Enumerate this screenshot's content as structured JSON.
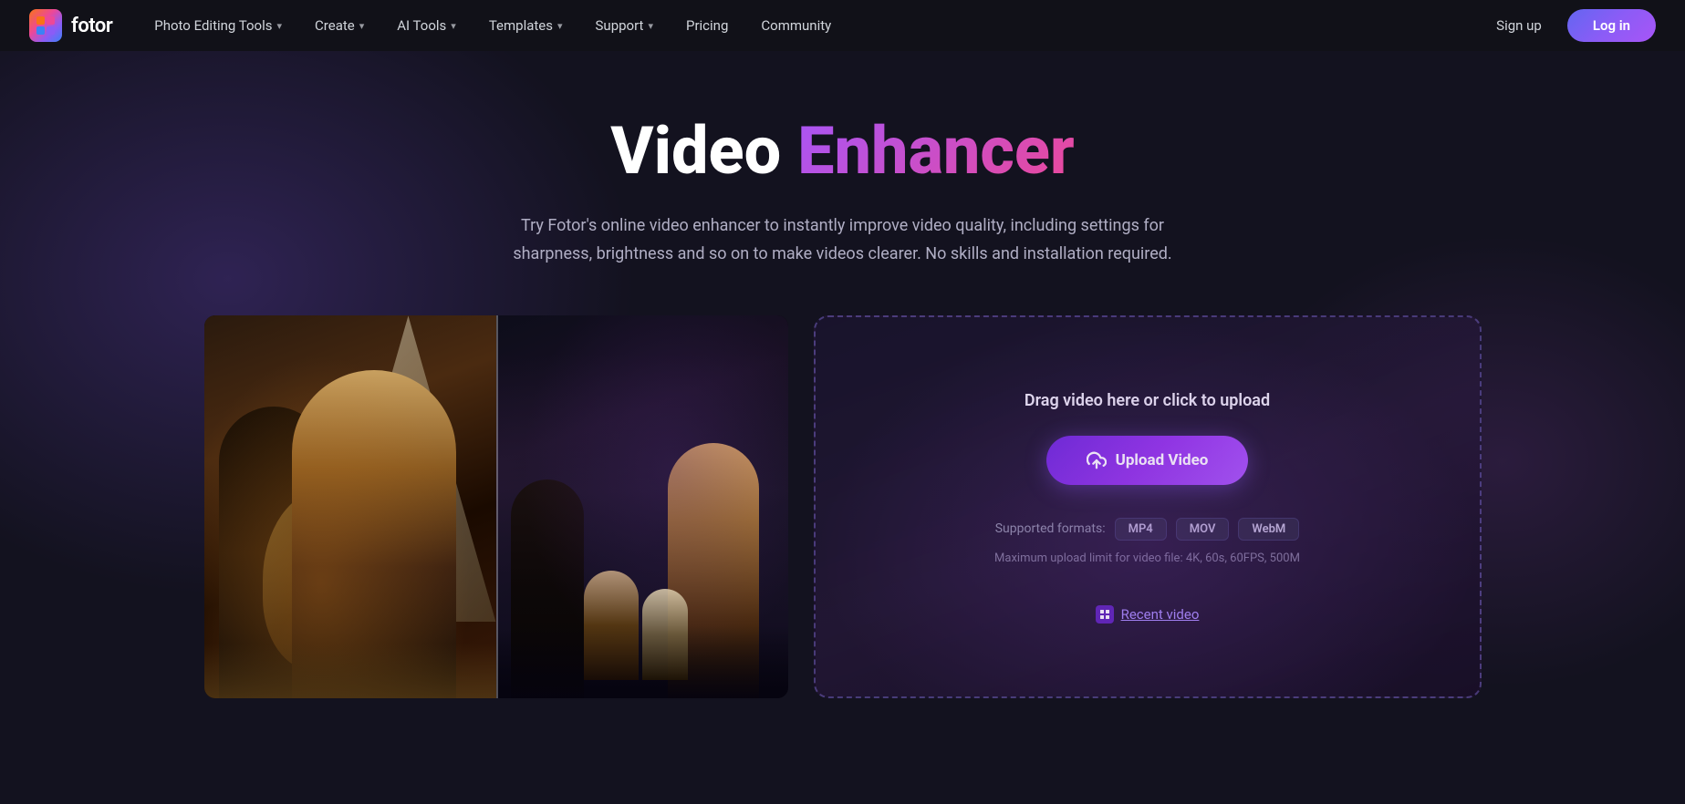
{
  "brand": {
    "logo_letter": "f",
    "name": "fotor"
  },
  "nav": {
    "items": [
      {
        "id": "photo-editing-tools",
        "label": "Photo Editing Tools",
        "has_dropdown": true
      },
      {
        "id": "create",
        "label": "Create",
        "has_dropdown": true
      },
      {
        "id": "ai-tools",
        "label": "AI Tools",
        "has_dropdown": true
      },
      {
        "id": "templates",
        "label": "Templates",
        "has_dropdown": true
      },
      {
        "id": "support",
        "label": "Support",
        "has_dropdown": true
      },
      {
        "id": "pricing",
        "label": "Pricing",
        "has_dropdown": false
      },
      {
        "id": "community",
        "label": "Community",
        "has_dropdown": false
      }
    ],
    "signup_label": "Sign up",
    "login_label": "Log in"
  },
  "hero": {
    "title_white": "Video",
    "title_purple": "Enhancer",
    "subtitle": "Try Fotor's online video enhancer to instantly improve video quality, including settings for sharpness, brightness and so on to make videos clearer. No skills and installation required."
  },
  "upload_panel": {
    "drag_text": "Drag video here or click to upload",
    "upload_btn_label": "Upload Video",
    "formats_label": "Supported formats:",
    "formats": [
      "MP4",
      "MOV",
      "WebM"
    ],
    "limit_text": "Maximum upload limit for video file: 4K, 60s, 60FPS, 500M",
    "recent_label": "Recent video"
  },
  "colors": {
    "accent_purple": "#8b5cf6",
    "accent_pink": "#ec4899",
    "brand_gradient_start": "#6d28d9",
    "brand_gradient_end": "#a855f7"
  }
}
